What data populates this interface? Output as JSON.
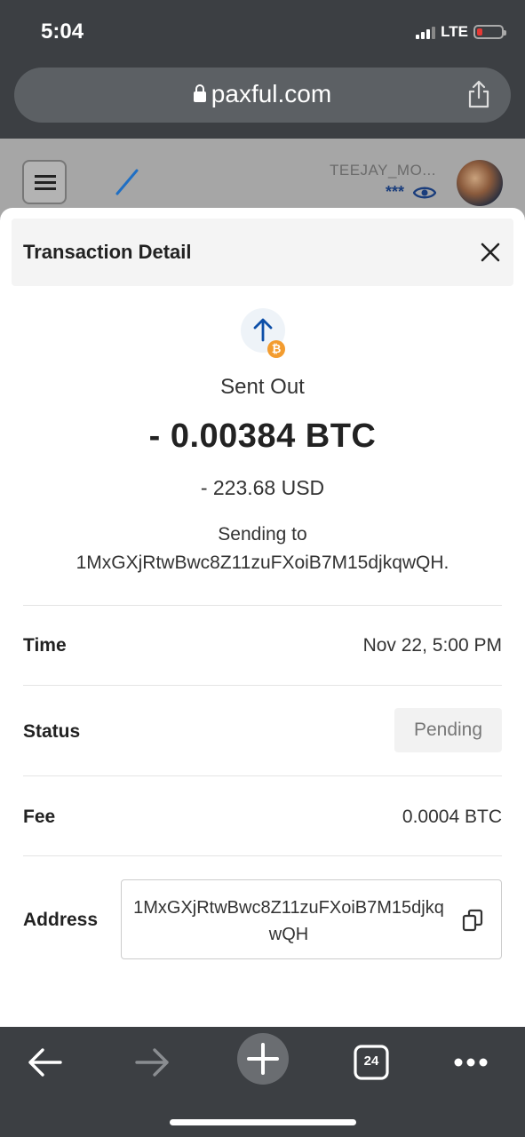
{
  "status_bar": {
    "time": "5:04",
    "network": "LTE"
  },
  "browser": {
    "url": "paxful.com",
    "tab_count": "24"
  },
  "page_header": {
    "username": "TEEJAY_MO...",
    "masked_balance": "***"
  },
  "transaction": {
    "title": "Transaction Detail",
    "direction": "Sent Out",
    "btc_amount": "- 0.00384 BTC",
    "usd_amount": "- 223.68 USD",
    "sending_to_label": "Sending to",
    "sending_to_address": "1MxGXjRtwBwc8Z11zuFXoiB7M15djkqwQH.",
    "coin_badge": "₿",
    "rows": {
      "time_label": "Time",
      "time_value": "Nov 22, 5:00 PM",
      "status_label": "Status",
      "status_value": "Pending",
      "fee_label": "Fee",
      "fee_value": "0.0004 BTC",
      "address_label": "Address",
      "address_value": "1MxGXjRtwBwc8Z11zuFXoiB7M15djkqwQH"
    }
  },
  "colors": {
    "accent": "#0d4fa8",
    "btc_orange": "#f39c2f",
    "browser_chrome": "#3c3f43"
  }
}
